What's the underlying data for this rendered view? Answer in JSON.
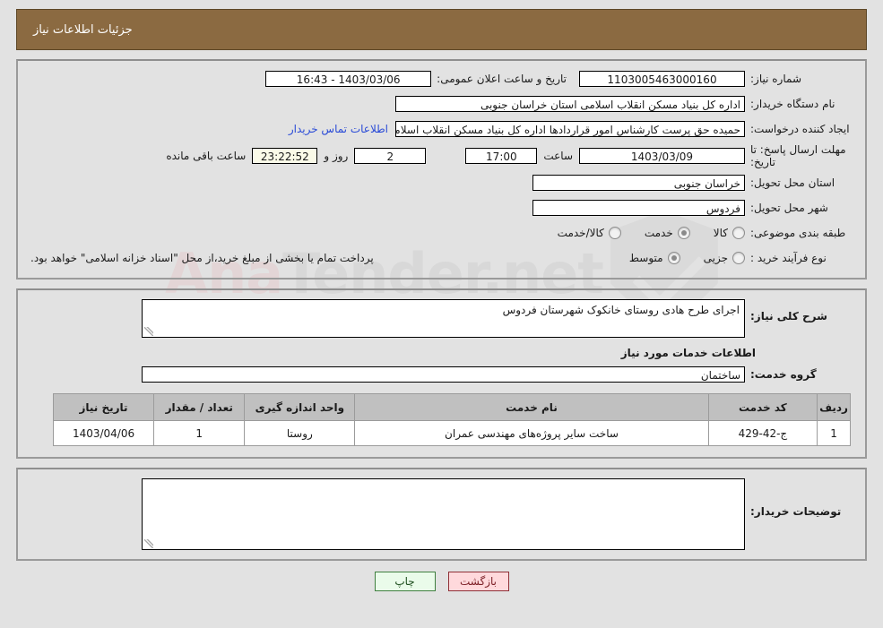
{
  "header": {
    "title": "جزئیات اطلاعات نیاز",
    "bar_color": "#8b6a41"
  },
  "watermark": {
    "text_left": "Ana",
    "text_right": "Tender.net"
  },
  "details": {
    "need_number": {
      "label": "شماره نیاز:",
      "value": "1103005463000160"
    },
    "public_announce": {
      "label": "تاریخ و ساعت اعلان عمومی:",
      "value": "1403/03/06 - 16:43"
    },
    "buyer_org": {
      "label": "نام دستگاه خریدار:",
      "value": "اداره کل بنیاد مسکن انقلاب اسلامی استان خراسان جنوبی"
    },
    "request_creator": {
      "label": "ایجاد کننده درخواست:",
      "value": "حمیده حق پرست کارشناس امور قراردادها اداره کل بنیاد مسکن انقلاب اسلامی",
      "contact_link": "اطلاعات تماس خریدار"
    },
    "deadline": {
      "label": "مهلت ارسال پاسخ: تا تاریخ:",
      "date": "1403/03/09",
      "hour_label": "ساعت",
      "hour": "17:00",
      "days": "2",
      "days_label": "روز و",
      "timer": "23:22:52",
      "remaining_label": "ساعت باقی مانده"
    },
    "delivery_province": {
      "label": "استان محل تحویل:",
      "value": "خراسان جنوبی"
    },
    "delivery_city": {
      "label": "شهر محل تحویل:",
      "value": "فردوس"
    },
    "category": {
      "label": "طبقه بندی موضوعی:",
      "options": [
        {
          "label": "کالا",
          "selected": false
        },
        {
          "label": "خدمت",
          "selected": true
        },
        {
          "label": "کالا/خدمت",
          "selected": false
        }
      ]
    },
    "purchase_type": {
      "label": "نوع فرآیند خرید :",
      "options": [
        {
          "label": "جزیی",
          "selected": false
        },
        {
          "label": "متوسط",
          "selected": true
        }
      ],
      "note": "پرداخت تمام یا بخشی از مبلغ خرید،از محل \"اسناد خزانه اسلامی\" خواهد بود."
    }
  },
  "general_description": {
    "label": "شرح کلی نیاز:",
    "value": "اجرای طرح هادی روستای خانکوک شهرستان فردوس"
  },
  "services_section": {
    "title": "اطلاعات خدمات مورد نیاز",
    "service_group": {
      "label": "گروه خدمت:",
      "value": "ساختمان"
    },
    "table": {
      "columns": [
        "ردیف",
        "کد خدمت",
        "نام خدمت",
        "واحد اندازه گیری",
        "تعداد / مقدار",
        "تاریخ نیاز"
      ],
      "rows": [
        {
          "index": "1",
          "code": "ج-42-429",
          "name": "ساخت سایر پروژه‌های مهندسی عمران",
          "unit": "روستا",
          "quantity": "1",
          "need_date": "1403/04/06"
        }
      ]
    }
  },
  "buyer_notes": {
    "label": "توضیحات خریدار:",
    "value": ""
  },
  "buttons": {
    "print": "چاپ",
    "back": "بازگشت"
  }
}
